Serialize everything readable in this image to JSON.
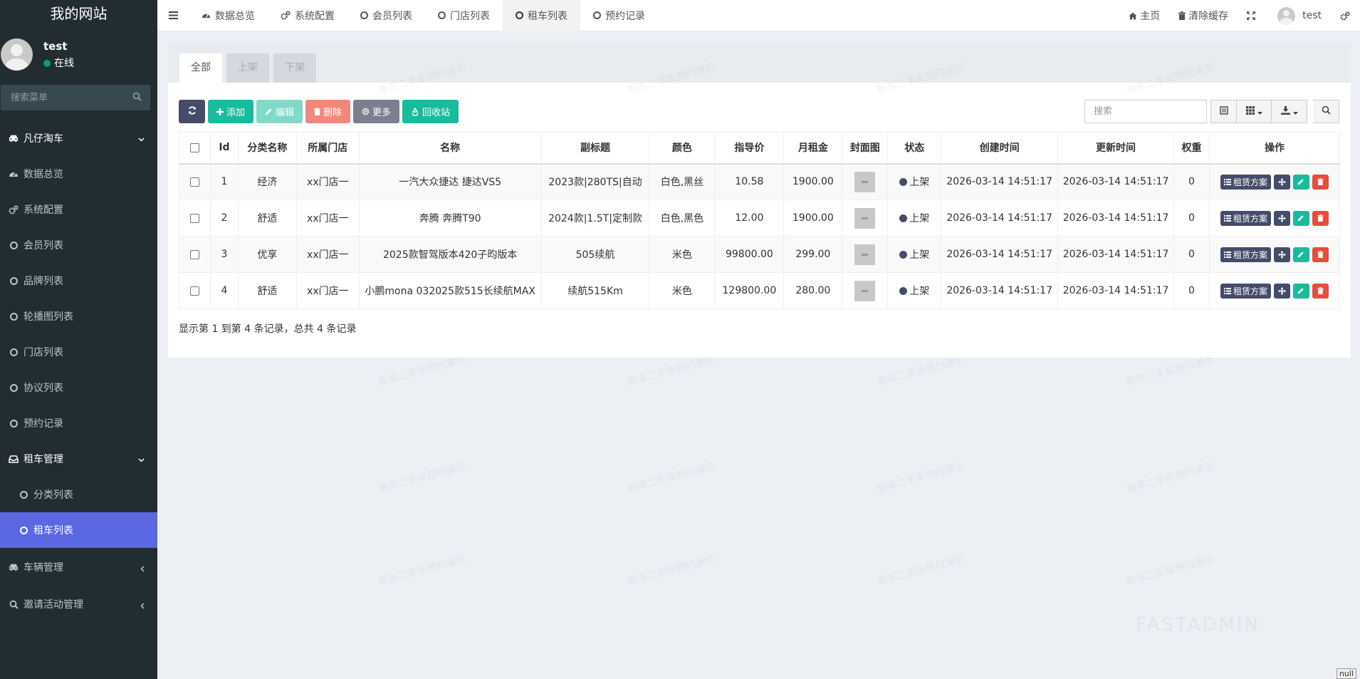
{
  "app": {
    "site_name": "我的网站"
  },
  "user": {
    "name": "test",
    "status": "在线"
  },
  "sidebar": {
    "search_placeholder": "搜索菜单",
    "items": [
      {
        "label": "凡仔淘车",
        "type": "header",
        "icon": "car-icon"
      },
      {
        "label": "数据总览",
        "icon": "dashboard-icon"
      },
      {
        "label": "系统配置",
        "icon": "cogs-icon"
      },
      {
        "label": "会员列表",
        "icon": "circle-icon"
      },
      {
        "label": "品牌列表",
        "icon": "circle-icon"
      },
      {
        "label": "轮播图列表",
        "icon": "circle-icon"
      },
      {
        "label": "门店列表",
        "icon": "circle-icon"
      },
      {
        "label": "协议列表",
        "icon": "circle-icon"
      },
      {
        "label": "预约记录",
        "icon": "circle-icon"
      },
      {
        "label": "租车管理",
        "type": "header",
        "icon": "inbox-icon"
      },
      {
        "label": "分类列表",
        "icon": "circle-icon"
      },
      {
        "label": "租车列表",
        "icon": "circle-icon",
        "active": true
      },
      {
        "label": "车辆管理",
        "icon": "car-icon"
      },
      {
        "label": "邀请活动管理",
        "icon": "search-icon"
      }
    ]
  },
  "topnav": {
    "tabs": [
      {
        "label": "数据总览",
        "icon": "dashboard-icon"
      },
      {
        "label": "系统配置",
        "icon": "cogs-icon"
      },
      {
        "label": "会员列表",
        "icon": "circle-icon"
      },
      {
        "label": "门店列表",
        "icon": "circle-icon"
      },
      {
        "label": "租车列表",
        "icon": "circle-icon",
        "active": true
      },
      {
        "label": "预约记录",
        "icon": "circle-icon"
      }
    ],
    "home": "主页",
    "clear_cache": "清除缓存",
    "user": "test"
  },
  "content": {
    "filter_tabs": [
      "全部",
      "上架",
      "下架"
    ],
    "toolbar": {
      "add": "添加",
      "edit": "编辑",
      "delete": "删除",
      "more": "更多",
      "recycle": "回收站"
    },
    "search_placeholder": "搜索",
    "columns": [
      "Id",
      "分类名称",
      "所属门店",
      "名称",
      "副标题",
      "颜色",
      "指导价",
      "月租金",
      "封面图",
      "状态",
      "创建时间",
      "更新时间",
      "权重",
      "操作"
    ],
    "rows": [
      {
        "id": "1",
        "category": "经济",
        "store": "xx门店一",
        "name": "一汽大众捷达 捷达VS5",
        "subtitle": "2023款|280TS|自动",
        "color": "白色,黑丝",
        "price": "10.58",
        "rent": "1900.00",
        "status": "上架",
        "created": "2026-03-14 14:51:17",
        "updated": "2026-03-14 14:51:17",
        "weight": "0"
      },
      {
        "id": "2",
        "category": "舒适",
        "store": "xx门店一",
        "name": "奔腾 奔腾T90",
        "subtitle": "2024款|1.5T|定制款",
        "color": "白色,黑色",
        "price": "12.00",
        "rent": "1900.00",
        "status": "上架",
        "created": "2026-03-14 14:51:17",
        "updated": "2026-03-14 14:51:17",
        "weight": "0"
      },
      {
        "id": "3",
        "category": "优享",
        "store": "xx门店一",
        "name": "2025款智驾版本420子昀版本",
        "subtitle": "505续航",
        "color": "米色",
        "price": "99800.00",
        "rent": "299.00",
        "status": "上架",
        "created": "2026-03-14 14:51:17",
        "updated": "2026-03-14 14:51:17",
        "weight": "0"
      },
      {
        "id": "4",
        "category": "舒适",
        "store": "xx门店一",
        "name": "小鹏mona 032025款515长续航MAX",
        "subtitle": "续航515Km",
        "color": "米色",
        "price": "129800.00",
        "rent": "280.00",
        "status": "上架",
        "created": "2026-03-14 14:51:17",
        "updated": "2026-03-14 14:51:17",
        "weight": "0"
      }
    ],
    "row_action": "租赁方案",
    "page_info": "显示第 1 到第 4 条记录，总共 4 条记录"
  },
  "watermark": "新车二手车预约演示",
  "brand_watermark": "FASTADMIN",
  "null_badge": "null"
}
